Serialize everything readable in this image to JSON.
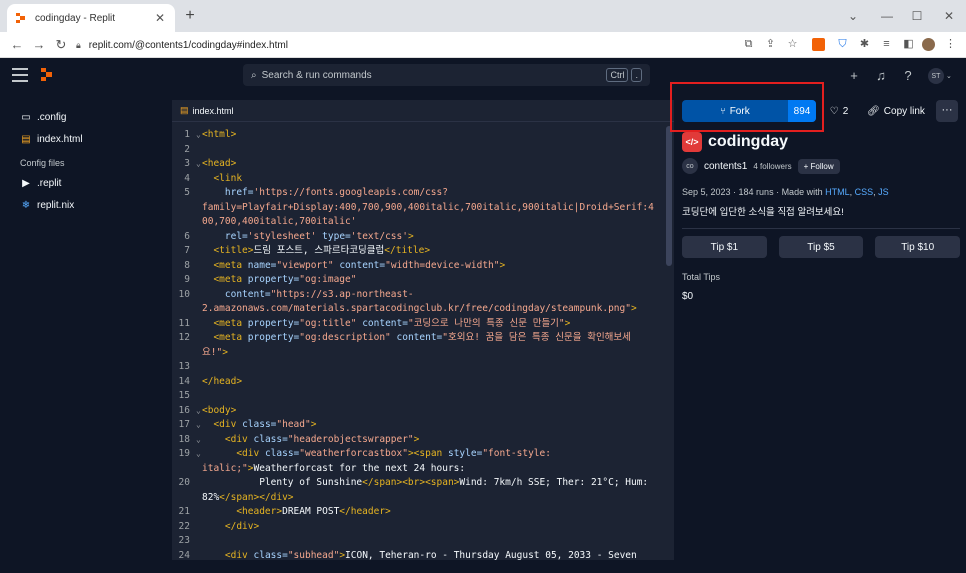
{
  "browser": {
    "tab_title": "codingday - Replit",
    "new_tab": "+",
    "url": "replit.com/@contents1/codingday#index.html"
  },
  "topbar": {
    "search_placeholder": "Search & run commands",
    "kbd_ctrl": "Ctrl",
    "kbd_dot": ".",
    "user_initials": "ST"
  },
  "sidebar": {
    "files": [
      ".config",
      "index.html"
    ],
    "section": "Config files",
    "config_files": [
      ".replit",
      "replit.nix"
    ]
  },
  "editor": {
    "tab": "index.html",
    "lines": [
      {
        "n": "1",
        "fold": "⌄",
        "segs": [
          [
            "t-tag",
            "<html>"
          ]
        ]
      },
      {
        "n": "2",
        "fold": "",
        "segs": []
      },
      {
        "n": "3",
        "fold": "⌄",
        "segs": [
          [
            "t-tag",
            "<head>"
          ]
        ]
      },
      {
        "n": "4",
        "fold": "",
        "segs": [
          [
            "t-plain",
            "  "
          ],
          [
            "t-tag",
            "<link"
          ]
        ]
      },
      {
        "n": "5",
        "fold": "",
        "segs": [
          [
            "t-plain",
            "    "
          ],
          [
            "t-attr",
            "href="
          ],
          [
            "t-str",
            "'https://fonts.googleapis.com/css?"
          ]
        ]
      },
      {
        "n": "",
        "fold": "",
        "segs": [
          [
            "t-str",
            "family=Playfair+Display:400,700,900,400italic,700italic,900italic|Droid+Serif:4"
          ]
        ]
      },
      {
        "n": "",
        "fold": "",
        "segs": [
          [
            "t-str",
            "00,700,400italic,700italic'"
          ]
        ]
      },
      {
        "n": "6",
        "fold": "",
        "segs": [
          [
            "t-plain",
            "    "
          ],
          [
            "t-attr",
            "rel="
          ],
          [
            "t-str",
            "'stylesheet'"
          ],
          [
            "t-plain",
            " "
          ],
          [
            "t-attr",
            "type="
          ],
          [
            "t-str",
            "'text/css'"
          ],
          [
            "t-tag",
            ">"
          ]
        ]
      },
      {
        "n": "7",
        "fold": "",
        "segs": [
          [
            "t-plain",
            "  "
          ],
          [
            "t-tag",
            "<title>"
          ],
          [
            "t-plain",
            "드림 포스트, 스파르타코딩클럽"
          ],
          [
            "t-tag",
            "</title>"
          ]
        ]
      },
      {
        "n": "8",
        "fold": "",
        "segs": [
          [
            "t-plain",
            "  "
          ],
          [
            "t-tag",
            "<meta "
          ],
          [
            "t-attr",
            "name="
          ],
          [
            "t-str",
            "\"viewport\""
          ],
          [
            "t-plain",
            " "
          ],
          [
            "t-attr",
            "content="
          ],
          [
            "t-str",
            "\"width=device-width\""
          ],
          [
            "t-tag",
            ">"
          ]
        ]
      },
      {
        "n": "9",
        "fold": "",
        "segs": [
          [
            "t-plain",
            "  "
          ],
          [
            "t-tag",
            "<meta "
          ],
          [
            "t-attr",
            "property="
          ],
          [
            "t-str",
            "\"og:image\""
          ]
        ]
      },
      {
        "n": "10",
        "fold": "",
        "segs": [
          [
            "t-plain",
            "    "
          ],
          [
            "t-attr",
            "content="
          ],
          [
            "t-str",
            "\"https://s3.ap-northeast-"
          ]
        ]
      },
      {
        "n": "",
        "fold": "",
        "segs": [
          [
            "t-str",
            "2.amazonaws.com/materials.spartacodingclub.kr/free/codingday/steampunk.png\""
          ],
          [
            "t-tag",
            ">"
          ]
        ]
      },
      {
        "n": "11",
        "fold": "",
        "segs": [
          [
            "t-plain",
            "  "
          ],
          [
            "t-tag",
            "<meta "
          ],
          [
            "t-attr",
            "property="
          ],
          [
            "t-str",
            "\"og:title\""
          ],
          [
            "t-plain",
            " "
          ],
          [
            "t-attr",
            "content="
          ],
          [
            "t-str",
            "\"코딩으로 나만의 특종 신문 만들기\""
          ],
          [
            "t-tag",
            ">"
          ]
        ]
      },
      {
        "n": "12",
        "fold": "",
        "segs": [
          [
            "t-plain",
            "  "
          ],
          [
            "t-tag",
            "<meta "
          ],
          [
            "t-attr",
            "property="
          ],
          [
            "t-str",
            "\"og:description\""
          ],
          [
            "t-plain",
            " "
          ],
          [
            "t-attr",
            "content="
          ],
          [
            "t-str",
            "\"호외요! 꿈을 담은 특종 신문을 확인해보세"
          ]
        ]
      },
      {
        "n": "",
        "fold": "",
        "segs": [
          [
            "t-str",
            "요!\""
          ],
          [
            "t-tag",
            ">"
          ]
        ]
      },
      {
        "n": "13",
        "fold": "",
        "segs": []
      },
      {
        "n": "14",
        "fold": "",
        "segs": [
          [
            "t-tag",
            "</head>"
          ]
        ]
      },
      {
        "n": "15",
        "fold": "",
        "segs": []
      },
      {
        "n": "16",
        "fold": "⌄",
        "segs": [
          [
            "t-tag",
            "<body>"
          ]
        ]
      },
      {
        "n": "17",
        "fold": "⌄",
        "segs": [
          [
            "t-plain",
            "  "
          ],
          [
            "t-tag",
            "<div "
          ],
          [
            "t-attr",
            "class="
          ],
          [
            "t-str",
            "\"head\""
          ],
          [
            "t-tag",
            ">"
          ]
        ]
      },
      {
        "n": "18",
        "fold": "⌄",
        "segs": [
          [
            "t-plain",
            "    "
          ],
          [
            "t-tag",
            "<div "
          ],
          [
            "t-attr",
            "class="
          ],
          [
            "t-str",
            "\"headerobjectswrapper\""
          ],
          [
            "t-tag",
            ">"
          ]
        ]
      },
      {
        "n": "19",
        "fold": "⌄",
        "segs": [
          [
            "t-plain",
            "      "
          ],
          [
            "t-tag",
            "<div "
          ],
          [
            "t-attr",
            "class="
          ],
          [
            "t-str",
            "\"weatherforcastbox\""
          ],
          [
            "t-tag",
            "><span "
          ],
          [
            "t-attr",
            "style="
          ],
          [
            "t-str",
            "\"font-style:"
          ]
        ]
      },
      {
        "n": "",
        "fold": "",
        "segs": [
          [
            "t-str",
            "italic;\""
          ],
          [
            "t-tag",
            ">"
          ],
          [
            "t-plain",
            "Weatherforcast for the next 24 hours:"
          ]
        ]
      },
      {
        "n": "20",
        "fold": "",
        "segs": [
          [
            "t-plain",
            "          Plenty of Sunshine"
          ],
          [
            "t-tag",
            "</span><br><span>"
          ],
          [
            "t-plain",
            "Wind: 7km/h SSE; Ther: 21°C; Hum:"
          ]
        ]
      },
      {
        "n": "",
        "fold": "",
        "segs": [
          [
            "t-plain",
            "82%"
          ],
          [
            "t-tag",
            "</span></div>"
          ]
        ]
      },
      {
        "n": "21",
        "fold": "",
        "segs": [
          [
            "t-plain",
            "      "
          ],
          [
            "t-tag",
            "<header>"
          ],
          [
            "t-plain",
            "DREAM POST"
          ],
          [
            "t-tag",
            "</header>"
          ]
        ]
      },
      {
        "n": "22",
        "fold": "",
        "segs": [
          [
            "t-plain",
            "    "
          ],
          [
            "t-tag",
            "</div>"
          ]
        ]
      },
      {
        "n": "23",
        "fold": "",
        "segs": []
      },
      {
        "n": "24",
        "fold": "",
        "segs": [
          [
            "t-plain",
            "    "
          ],
          [
            "t-tag",
            "<div "
          ],
          [
            "t-attr",
            "class="
          ],
          [
            "t-str",
            "\"subhead\""
          ],
          [
            "t-tag",
            ">"
          ],
          [
            "t-plain",
            "ICON, Teheran-ro - Thursday August 05, 2033 - Seven"
          ]
        ]
      }
    ]
  },
  "repl": {
    "fork_label": "Fork",
    "fork_count": "894",
    "like_count": "2",
    "copy_link": "Copy link",
    "more": "···",
    "name": "codingday",
    "icon_text": "</>",
    "owner": "contents1",
    "owner_initials": "co",
    "followers": "4 followers",
    "follow": "+ Follow",
    "meta_prefix": "Sep 5, 2023 · 184 runs · Made with ",
    "meta_langs": [
      "HTML",
      "CSS",
      "JS"
    ],
    "description": "코딩단에 입단한 소식을 직접 알려보세요!",
    "tips": [
      "Tip $1",
      "Tip $5",
      "Tip $10"
    ],
    "total_tips_label": "Total Tips",
    "total_tips_value": "$0"
  },
  "colors": {
    "accent": "#0079f2",
    "highlight": "#e31f1f",
    "repl_icon": "#e13a39"
  }
}
